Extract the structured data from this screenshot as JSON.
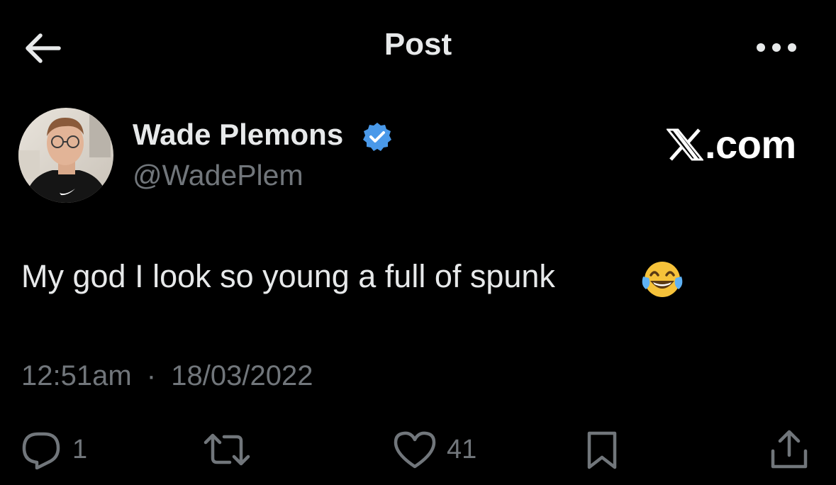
{
  "header": {
    "back_icon": "arrow-left-icon",
    "title": "Post",
    "more_icon": "more-horizontal-icon"
  },
  "author": {
    "display_name": "Wade Plemons",
    "handle": "@WadePlem",
    "verified_icon": "verified-badge-icon",
    "verified_color": "#4a99e9"
  },
  "watermark": {
    "logo_icon": "x-logo-icon",
    "text": ".com"
  },
  "post": {
    "text": "My god I look so young a full of spunk",
    "emoji": "face-with-tears-of-joy-icon"
  },
  "meta": {
    "time": "12:51am",
    "separator": "·",
    "date": "18/03/2022"
  },
  "actions": {
    "reply_count": "1",
    "repost_count": "",
    "like_count": "41",
    "icons": [
      "reply-icon",
      "repost-icon",
      "like-icon",
      "bookmark-icon",
      "share-icon"
    ]
  },
  "colors": {
    "background": "#000000",
    "primary_text": "#e7e9ea",
    "secondary_text": "#71767b"
  }
}
